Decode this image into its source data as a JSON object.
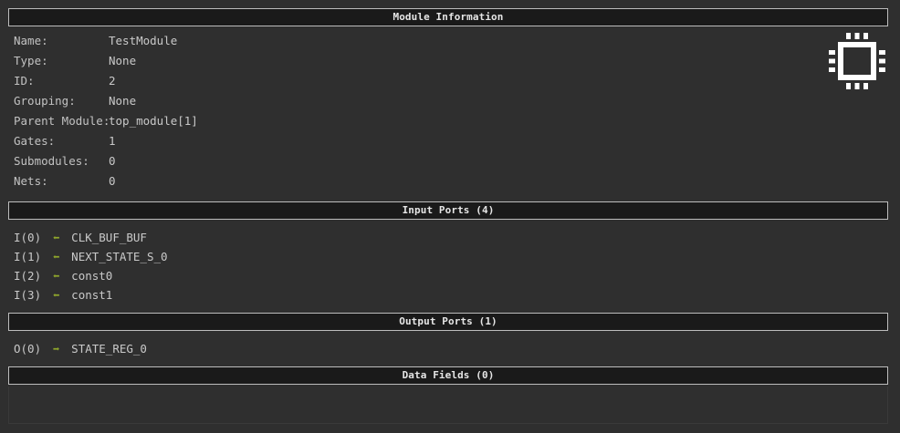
{
  "module_info": {
    "header": "Module Information",
    "rows": [
      {
        "key": "Name:",
        "value": "TestModule"
      },
      {
        "key": "Type:",
        "value": "None"
      },
      {
        "key": "ID:",
        "value": "2"
      },
      {
        "key": "Grouping:",
        "value": "None"
      },
      {
        "key": "Parent Module:",
        "value": "top_module[1]"
      },
      {
        "key": "Gates:",
        "value": "1"
      },
      {
        "key": "Submodules:",
        "value": "0"
      },
      {
        "key": "Nets:",
        "value": "0"
      }
    ],
    "icon": "chip-icon"
  },
  "input_ports": {
    "header": "Input Ports (4)",
    "items": [
      {
        "port": "I(0)",
        "arrow": "⬅",
        "net": "CLK_BUF_BUF"
      },
      {
        "port": "I(1)",
        "arrow": "⬅",
        "net": "NEXT_STATE_S_0"
      },
      {
        "port": "I(2)",
        "arrow": "⬅",
        "net": "const0"
      },
      {
        "port": "I(3)",
        "arrow": "⬅",
        "net": "const1"
      }
    ]
  },
  "output_ports": {
    "header": "Output Ports (1)",
    "items": [
      {
        "port": "O(0)",
        "arrow": "➡",
        "net": "STATE_REG_0"
      }
    ]
  },
  "data_fields": {
    "header": "Data Fields (0)"
  },
  "colors": {
    "background": "#2f2f2f",
    "header_bg": "#1a1a1a",
    "header_border": "#bdbdbd",
    "arrow": "#8fa62c",
    "text": "#c9c9c9"
  }
}
